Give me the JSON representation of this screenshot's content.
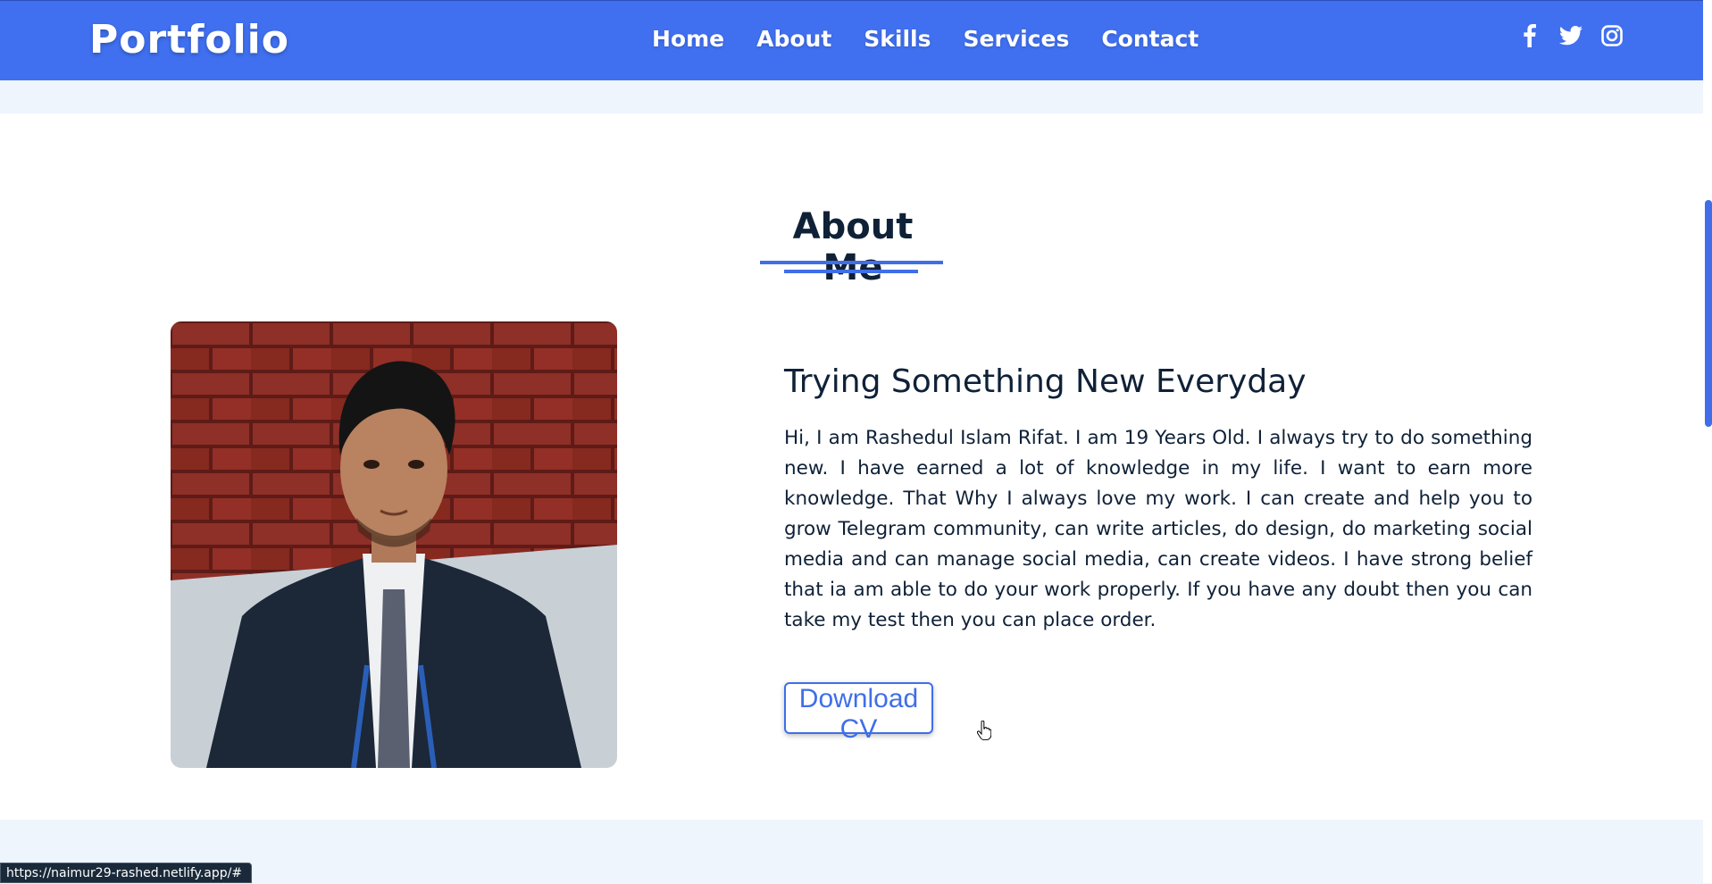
{
  "navbar": {
    "brand": "Portfolio",
    "links": [
      "Home",
      "About",
      "Skills",
      "Services",
      "Contact"
    ],
    "socials": [
      "facebook-icon",
      "twitter-icon",
      "instagram-icon"
    ]
  },
  "about": {
    "title": "About Me",
    "subtitle": "Trying Something New Everyday",
    "paragraph": "Hi, I am Rashedul Islam Rifat. I am 19 Years Old. I always try to do something new. I have earned a lot of knowledge in my life. I want to earn more knowledge. That Why I always love my work. I can create and help you to grow Telegram community, can write articles, do design, do marketing social media and can manage social media, can create videos. I have strong belief that ia am able to do your work properly. If you have any doubt then you can take my test then you can place order.",
    "button": "Download CV"
  },
  "status_bar": {
    "url": "https://naimur29-rashed.netlify.app/#"
  },
  "colors": {
    "accent": "#4070f0",
    "text": "#0f2137",
    "section_bg": "#eef5fd"
  }
}
